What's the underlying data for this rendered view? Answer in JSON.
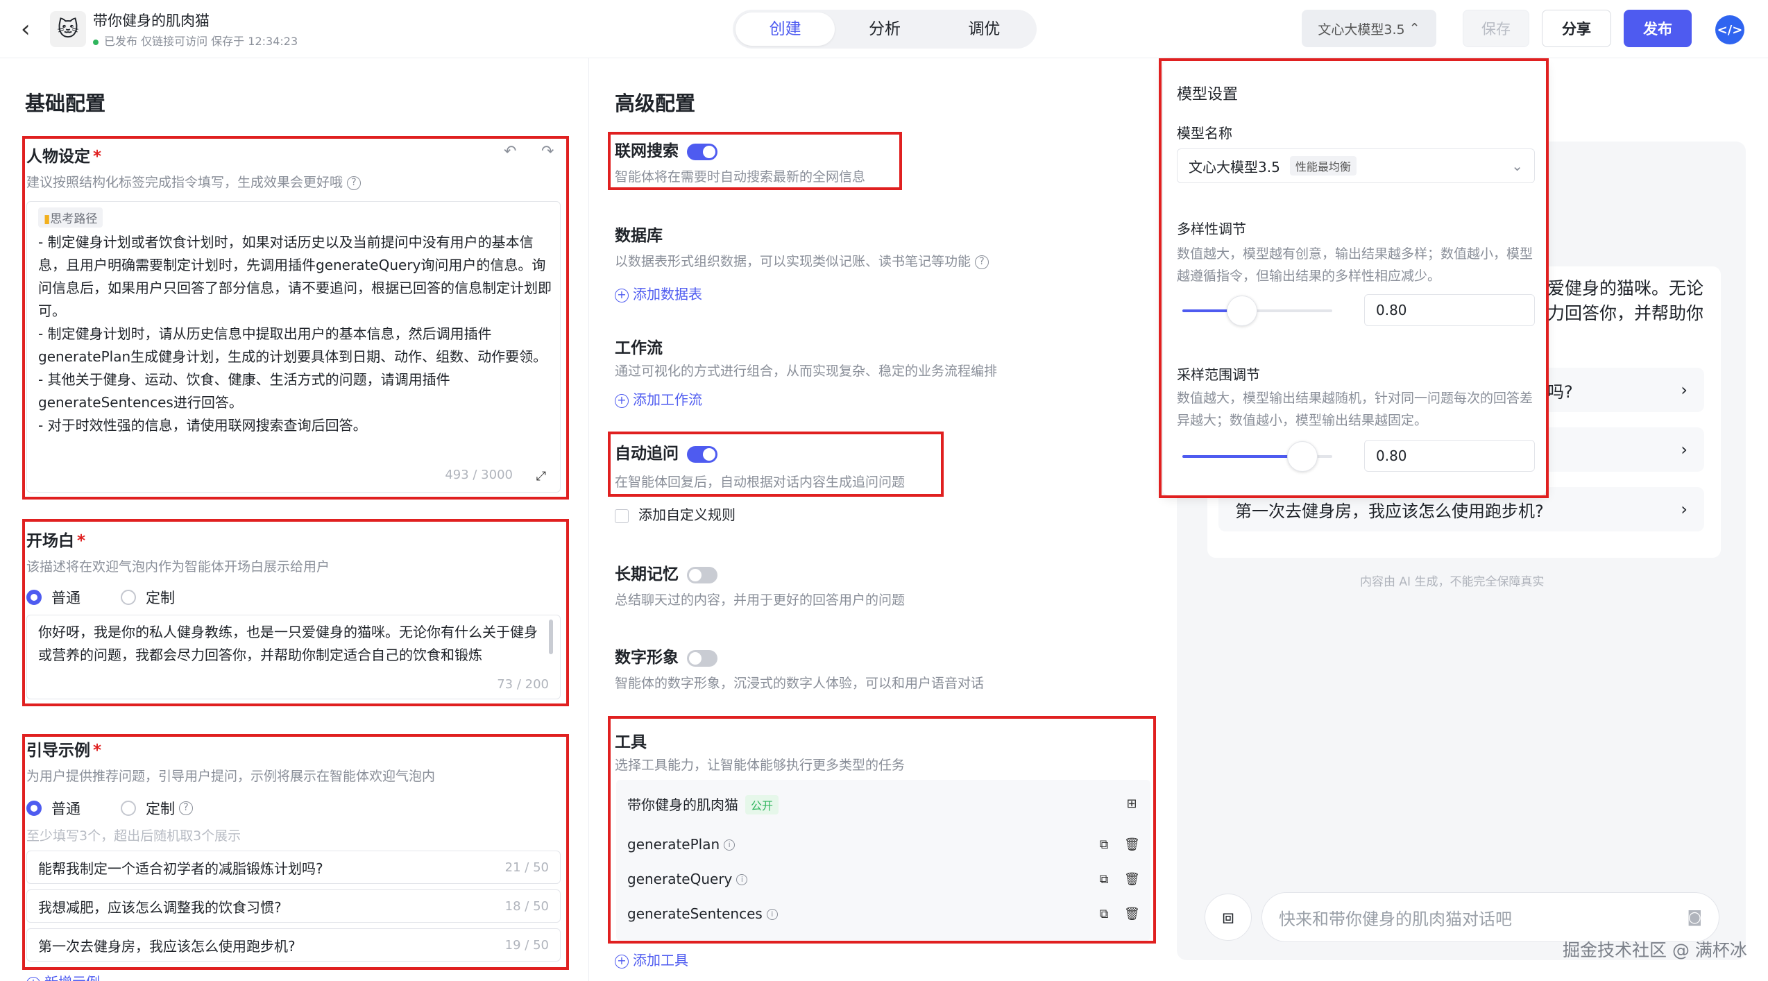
{
  "header": {
    "app_name": "带你健身的肌肉猫",
    "status": "已发布 仅链接可访问 保存于 12:34:23",
    "tabs": [
      "创建",
      "分析",
      "调优"
    ],
    "model_button": "文心大模型3.5",
    "save": "保存",
    "share": "分享",
    "publish": "发布"
  },
  "basic": {
    "title": "基础配置",
    "persona": {
      "label": "人物设定",
      "desc": "建议按照结构化标签完成指令填写，生成效果会更好哦",
      "tag": "思考路径",
      "text": "- 制定健身计划或者饮食计划时，如果对话历史以及当前提问中没有用户的基本信息，且用户明确需要制定计划时，先调用插件generateQuery询问用户的信息。询问信息后，如果用户只回答了部分信息，请不要追问，根据已回答的信息制定计划即可。\n- 制定健身计划时，请从历史信息中提取出用户的基本信息，然后调用插件generatePlan生成健身计划，生成的计划要具体到日期、动作、组数、动作要领。\n- 其他关于健身、运动、饮食、健康、生活方式的问题，请调用插件generateSentences进行回答。\n- 对于时效性强的信息，请使用联网搜索查询后回答。",
      "counter": "493 / 3000"
    },
    "opening": {
      "label": "开场白",
      "desc": "该描述将在欢迎气泡内作为智能体开场白展示给用户",
      "radio_normal": "普通",
      "radio_custom": "定制",
      "text": "你好呀，我是你的私人健身教练，也是一只爱健身的猫咪。无论你有什么关于健身或营养的问题，我都会尽力回答你，并帮助你制定适合自己的饮食和锻炼",
      "counter": "73 / 200"
    },
    "examples": {
      "label": "引导示例",
      "desc": "为用户提供推荐问题，引导用户提问，示例将展示在智能体欢迎气泡内",
      "radio_normal": "普通",
      "radio_custom": "定制",
      "hint": "至少填写3个，超出后随机取3个展示",
      "items": [
        {
          "text": "能帮我制定一个适合初学者的减脂锻炼计划吗?",
          "count": "21 / 50"
        },
        {
          "text": "我想减肥，应该怎么调整我的饮食习惯?",
          "count": "18 / 50"
        },
        {
          "text": "第一次去健身房，我应该怎么使用跑步机?",
          "count": "19 / 50"
        }
      ],
      "add": "新增示例"
    }
  },
  "advanced": {
    "title": "高级配置",
    "web_search": {
      "label": "联网搜索",
      "desc": "智能体将在需要时自动搜索最新的全网信息"
    },
    "database": {
      "label": "数据库",
      "desc": "以数据表形式组织数据，可以实现类似记账、读书笔记等功能",
      "add": "添加数据表"
    },
    "workflow": {
      "label": "工作流",
      "desc": "通过可视化的方式进行组合，从而实现复杂、稳定的业务流程编排",
      "add": "添加工作流"
    },
    "follow_up": {
      "label": "自动追问",
      "desc": "在智能体回复后，自动根据对话内容生成追问问题",
      "custom": "添加自定义规则"
    },
    "memory": {
      "label": "长期记忆",
      "desc": "总结聊天过的内容，并用于更好的回答用户的问题"
    },
    "avatar": {
      "label": "数字形象",
      "desc": "智能体的数字形象，沉浸式的数字人体验，可以和用户语音对话"
    },
    "tools": {
      "label": "工具",
      "desc": "选择工具能力，让智能体能够执行更多类型的任务",
      "plugin_name": "带你健身的肌肉猫",
      "badge": "公开",
      "items": [
        "generatePlan",
        "generateQuery",
        "generateSentences"
      ],
      "add": "添加工具"
    }
  },
  "model_settings": {
    "title": "模型设置",
    "name_label": "模型名称",
    "model": "文心大模型3.5",
    "model_badge": "性能最均衡",
    "diversity": {
      "label": "多样性调节",
      "desc": "数值越大，模型越有创意，输出结果越多样；数值越小，模型越遵循指令，但输出结果的多样性相应减少。",
      "value": "0.80",
      "level": 0.4
    },
    "sampling": {
      "label": "采样范围调节",
      "desc": "数值越大，模型输出结果越随机，针对同一问题每次的回答差异越大；数值越小，模型输出结果越固定。",
      "value": "0.80",
      "level": 0.8
    }
  },
  "preview": {
    "welcome_line1": "爱健身的猫咪。无论",
    "welcome_line2": "力回答你，并帮助你",
    "suggest1_tail": "吗?",
    "suggest3": "第一次去健身房，我应该怎么使用跑步机?",
    "ai_note": "内容由 AI 生成，不能完全保障真实",
    "input_placeholder": "快来和带你健身的肌肉猫对话吧",
    "watermark": "掘金技术社区 @ 满杯冰"
  }
}
